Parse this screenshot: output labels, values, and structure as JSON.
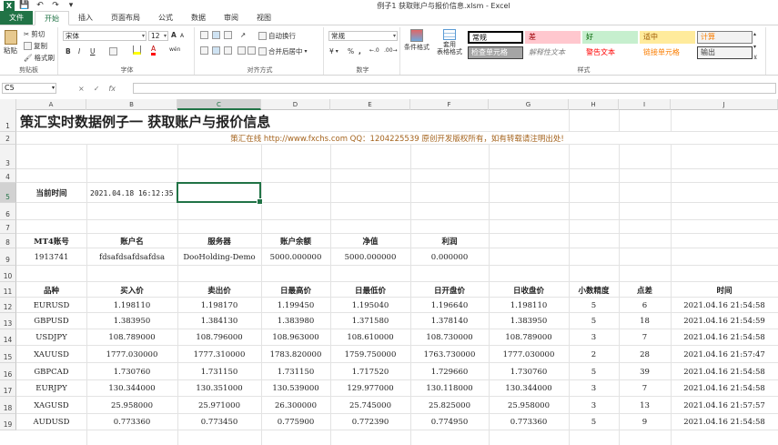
{
  "window": {
    "title": "例子1 获取账户与报价信息.xlsm - Excel"
  },
  "tabs": [
    "文件",
    "开始",
    "插入",
    "页面布局",
    "公式",
    "数据",
    "审阅",
    "视图"
  ],
  "ribbon": {
    "clipboard": {
      "paste": "粘贴",
      "cut": "剪切",
      "copy": "复制",
      "format_painter": "格式刷",
      "label": "剪贴板"
    },
    "font": {
      "name": "宋体",
      "size": "12",
      "label": "字体",
      "bold": "B",
      "italic": "I",
      "underline": "U",
      "font_color_a": "A",
      "grow": "A",
      "shrink": "A",
      "wen": "wén"
    },
    "alignment": {
      "wrap": "自动换行",
      "merge": "合并后居中",
      "label": "对齐方式"
    },
    "number": {
      "format": "常规",
      "label": "数字",
      "percent": "%",
      "comma": ",",
      "currency": "¥"
    },
    "styles": {
      "cond_format": "条件格式",
      "table_format": "套用\n表格格式",
      "label": "样式",
      "cells": [
        {
          "text": "常规",
          "bg": "#ffffff",
          "fg": "#000000",
          "border": "#000000"
        },
        {
          "text": "差",
          "bg": "#ffc7ce",
          "fg": "#9c0006",
          "border": "#ffc7ce"
        },
        {
          "text": "好",
          "bg": "#c6efce",
          "fg": "#006100",
          "border": "#c6efce"
        },
        {
          "text": "适中",
          "bg": "#ffeb9c",
          "fg": "#9c5700",
          "border": "#ffeb9c"
        },
        {
          "text": "计算",
          "bg": "#f2f2f2",
          "fg": "#fa7d00",
          "border": "#7f7f7f"
        },
        {
          "text": "检查单元格",
          "bg": "#a5a5a5",
          "fg": "#ffffff",
          "border": "#3f3f3f"
        },
        {
          "text": "解释性文本",
          "bg": "#ffffff",
          "fg": "#7f7f7f",
          "border": "#ffffff"
        },
        {
          "text": "警告文本",
          "bg": "#ffffff",
          "fg": "#ff0000",
          "border": "#ffffff"
        },
        {
          "text": "链接单元格",
          "bg": "#ffffff",
          "fg": "#fa7d00",
          "border": "#ffffff"
        },
        {
          "text": "输出",
          "bg": "#f2f2f2",
          "fg": "#3f3f3f",
          "border": "#3f3f3f"
        }
      ]
    }
  },
  "formula_bar": {
    "name_box": "C5",
    "cancel": "×",
    "enter": "✓",
    "fx": "fx",
    "content": ""
  },
  "columns": [
    "A",
    "B",
    "C",
    "D",
    "E",
    "F",
    "G",
    "H",
    "I",
    "J"
  ],
  "selected_column": "C",
  "selected_row": "5",
  "rows": [
    "1",
    "2",
    "3",
    "4",
    "5",
    "6",
    "7",
    "8",
    "9",
    "10",
    "11",
    "12",
    "13",
    "14",
    "15",
    "16",
    "17",
    "18",
    "19"
  ],
  "sheet": {
    "title": "策汇实时数据例子一   获取账户与报价信息",
    "subtitle": "策汇在线   http://www.fxchs.com   QQ：1204225539   原创开发版权所有，如有转载请注明出处!",
    "current_time_label": "当前时间",
    "current_time_value": "2021.04.18 16:12:35",
    "account_headers": [
      "MT4账号",
      "账户名",
      "服务器",
      "账户余额",
      "净值",
      "利润"
    ],
    "account_values": [
      "1913741",
      "fdsafdsafdsafdsa",
      "DooHolding-Demo",
      "5000.000000",
      "5000.000000",
      "0.000000"
    ],
    "quote_headers": [
      "品种",
      "买入价",
      "卖出价",
      "日最高价",
      "日最低价",
      "日开盘价",
      "日收盘价",
      "小数精度",
      "点差",
      "时间"
    ],
    "quotes": [
      [
        "EURUSD",
        "1.198110",
        "1.198170",
        "1.199450",
        "1.195040",
        "1.196640",
        "1.198110",
        "5",
        "6",
        "2021.04.16 21:54:58"
      ],
      [
        "GBPUSD",
        "1.383950",
        "1.384130",
        "1.383980",
        "1.371580",
        "1.378140",
        "1.383950",
        "5",
        "18",
        "2021.04.16 21:54:59"
      ],
      [
        "USDJPY",
        "108.789000",
        "108.796000",
        "108.963000",
        "108.610000",
        "108.730000",
        "108.789000",
        "3",
        "7",
        "2021.04.16 21:54:58"
      ],
      [
        "XAUUSD",
        "1777.030000",
        "1777.310000",
        "1783.820000",
        "1759.750000",
        "1763.730000",
        "1777.030000",
        "2",
        "28",
        "2021.04.16 21:57:47"
      ],
      [
        "GBPCAD",
        "1.730760",
        "1.731150",
        "1.731150",
        "1.717520",
        "1.729660",
        "1.730760",
        "5",
        "39",
        "2021.04.16 21:54:58"
      ],
      [
        "EURJPY",
        "130.344000",
        "130.351000",
        "130.539000",
        "129.977000",
        "130.118000",
        "130.344000",
        "3",
        "7",
        "2021.04.16 21:54:58"
      ],
      [
        "XAGUSD",
        "25.958000",
        "25.971000",
        "26.300000",
        "25.745000",
        "25.825000",
        "25.958000",
        "3",
        "13",
        "2021.04.16 21:57:57"
      ],
      [
        "AUDUSD",
        "0.773360",
        "0.773450",
        "0.775900",
        "0.772390",
        "0.774950",
        "0.773360",
        "5",
        "9",
        "2021.04.16 21:54:58"
      ]
    ]
  }
}
